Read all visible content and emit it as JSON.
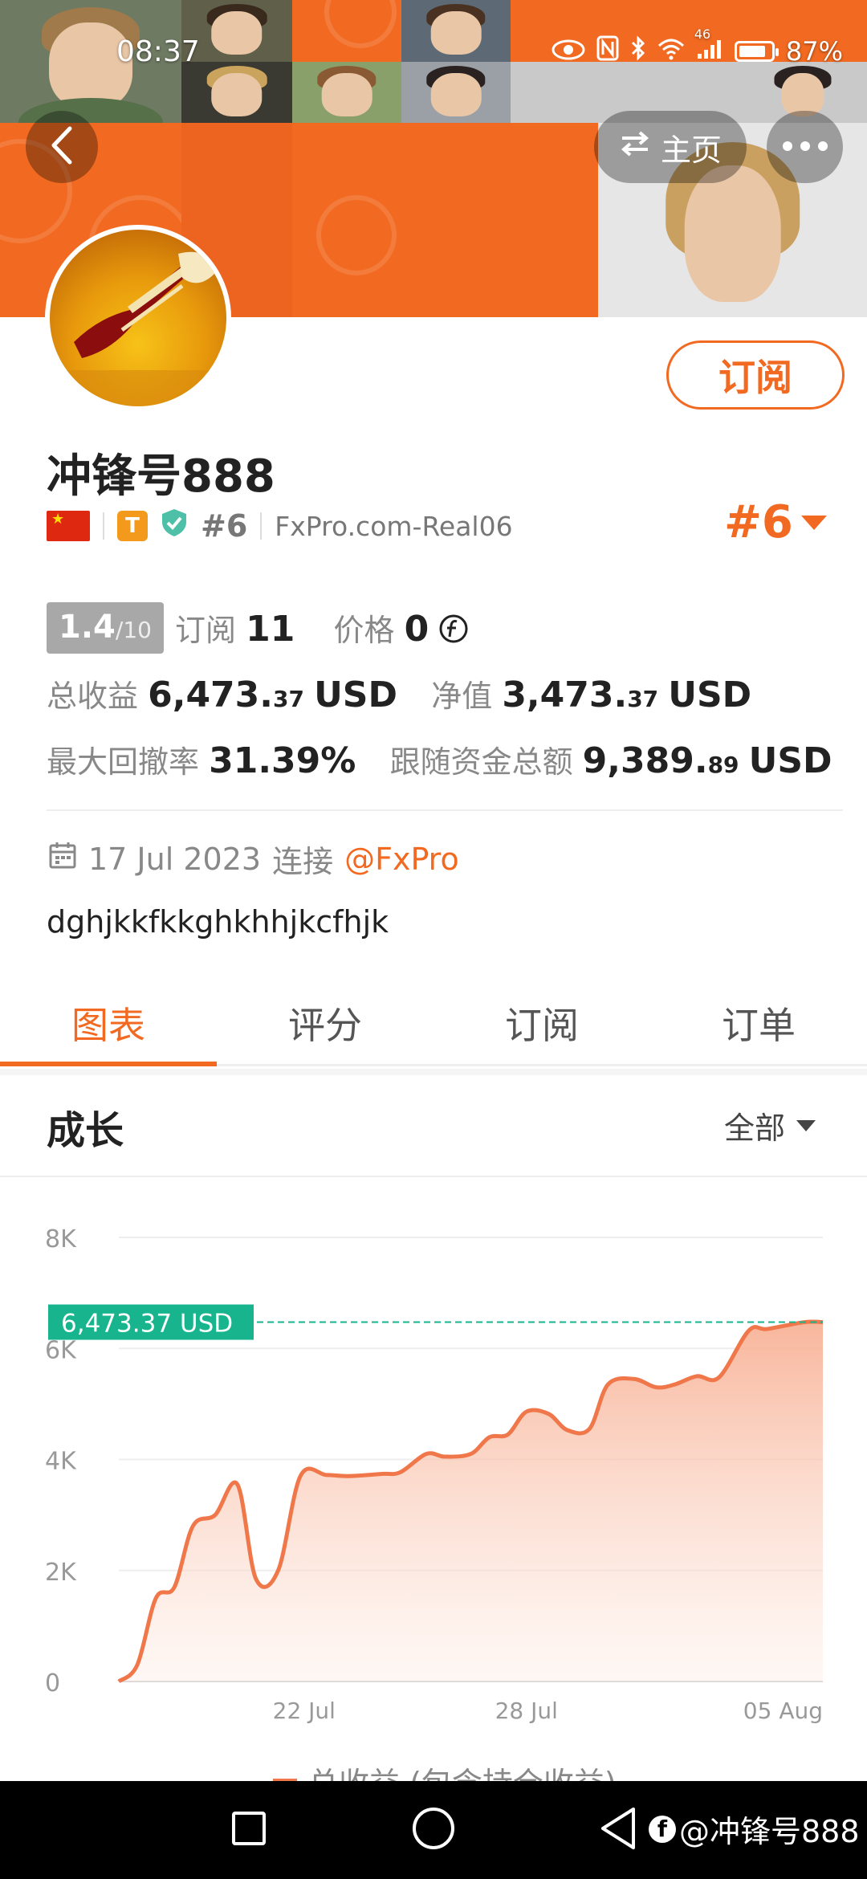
{
  "status_bar": {
    "time": "08:37",
    "battery": "87%",
    "network": "46"
  },
  "header": {
    "home_label": "主页"
  },
  "profile": {
    "subscribe_label": "订阅",
    "name": "冲锋号888",
    "rank": "#6",
    "broker_account": "FxPro.com-Real06",
    "rank_top": "#6"
  },
  "stats": {
    "score": "1.4",
    "score_max": "/10",
    "subscribe_label": "订阅",
    "subscribe_count": "11",
    "price_label": "价格",
    "price_value": "0",
    "total_profit_label": "总收益",
    "total_profit_main": "6,473.",
    "total_profit_cents": "37",
    "total_profit_unit": "USD",
    "equity_label": "净值",
    "equity_main": "3,473.",
    "equity_cents": "37",
    "equity_unit": "USD",
    "drawdown_label": "最大回撤率",
    "drawdown_value": "31.39%",
    "follow_funds_label": "跟随资金总额",
    "follow_funds_main": "9,389.",
    "follow_funds_cents": "89",
    "follow_funds_unit": "USD"
  },
  "connection": {
    "date": "17 Jul 2023",
    "connect_label": "连接",
    "broker_link": "@FxPro"
  },
  "bio": "dghjkkfkkghkhhjkcfhjk",
  "tabs": [
    {
      "label": "图表",
      "active": true
    },
    {
      "label": "评分",
      "active": false
    },
    {
      "label": "订阅",
      "active": false
    },
    {
      "label": "订单",
      "active": false
    }
  ],
  "growth": {
    "title": "成长",
    "range": "全部"
  },
  "chart_data": {
    "type": "area",
    "yticks": [
      "0",
      "2K",
      "4K",
      "6K",
      "8K"
    ],
    "ylim": [
      0,
      8000
    ],
    "xticks": [
      {
        "label": "22 Jul",
        "x": 5
      },
      {
        "label": "28 Jul",
        "x": 11
      },
      {
        "label": "05 Aug",
        "x": 19
      }
    ],
    "xlim": [
      0,
      19
    ],
    "current_label": "6,473.37 USD",
    "current_value": 6473.37,
    "series": [
      {
        "name": "总收益 (包含持仓收益)",
        "x": [
          0,
          0.5,
          1,
          1.5,
          2,
          2.6,
          3.2,
          3.7,
          4.3,
          4.9,
          5.6,
          6.2,
          7.1,
          7.6,
          8.3,
          8.8,
          9.5,
          10,
          10.5,
          11,
          11.6,
          12.1,
          12.7,
          13.2,
          13.9,
          14.5,
          15,
          15.6,
          16.2,
          17,
          17.5,
          18.5,
          19
        ],
        "values": [
          0,
          300,
          1500,
          1700,
          2800,
          3000,
          3550,
          1850,
          2000,
          3700,
          3720,
          3700,
          3740,
          3770,
          4100,
          4050,
          4100,
          4400,
          4450,
          4860,
          4820,
          4530,
          4550,
          5350,
          5450,
          5300,
          5350,
          5500,
          5480,
          6320,
          6350,
          6473,
          6473
        ]
      }
    ],
    "line_color": "#f0774a",
    "label_color": "#17b48e"
  },
  "nav": {
    "watermark": "@冲锋号888"
  },
  "colors": {
    "accent": "#f26a21",
    "badge_teal": "#17b48e"
  }
}
